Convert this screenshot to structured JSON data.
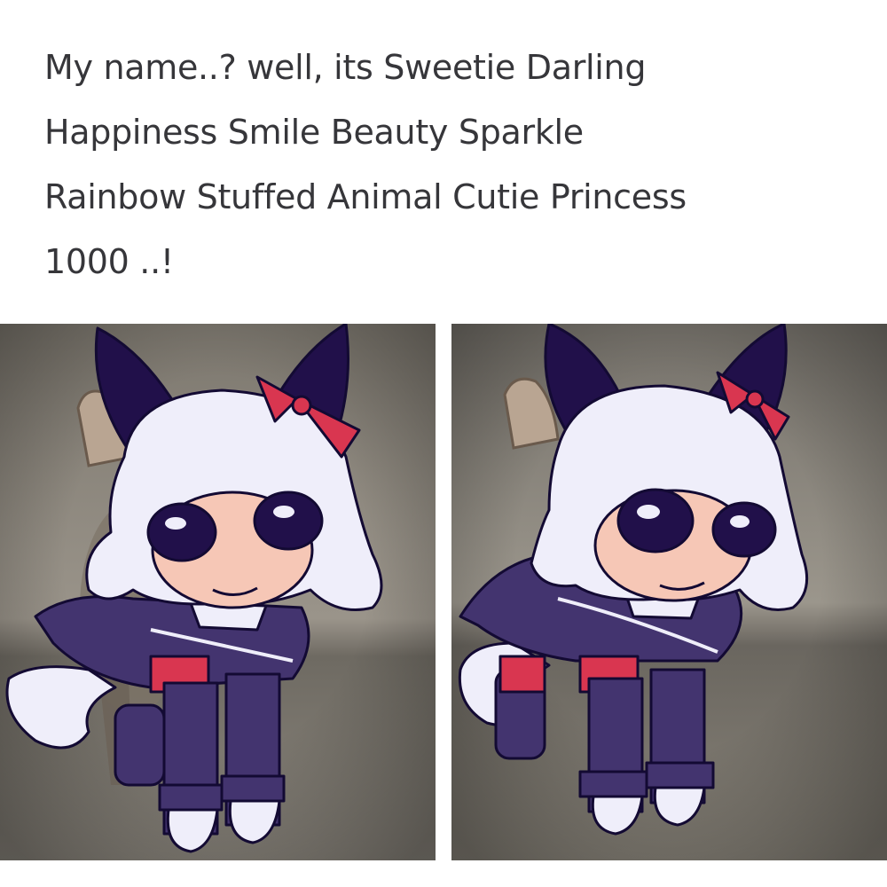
{
  "caption": {
    "lines": [
      "My name..? well, its Sweetie Darling",
      "Happiness Smile Beauty Sparkle",
      "Rainbow Stuffed Animal Cutie Princess",
      "1000 ..!"
    ]
  },
  "colors": {
    "background": "#ffffff",
    "caption_text": "#36363a",
    "hair": "#efeefa",
    "ears": "#21104a",
    "jacket": "#43346f",
    "skin": "#f6c7b6",
    "bow": "#d93650",
    "outline": "#130a33",
    "photo_wall": "#8a8478",
    "photo_floor": "#6d6a63"
  },
  "panels": [
    {
      "name": "left-photo",
      "icon": "chibi-cat-drawing"
    },
    {
      "name": "right-photo",
      "icon": "chibi-cat-drawing"
    }
  ]
}
